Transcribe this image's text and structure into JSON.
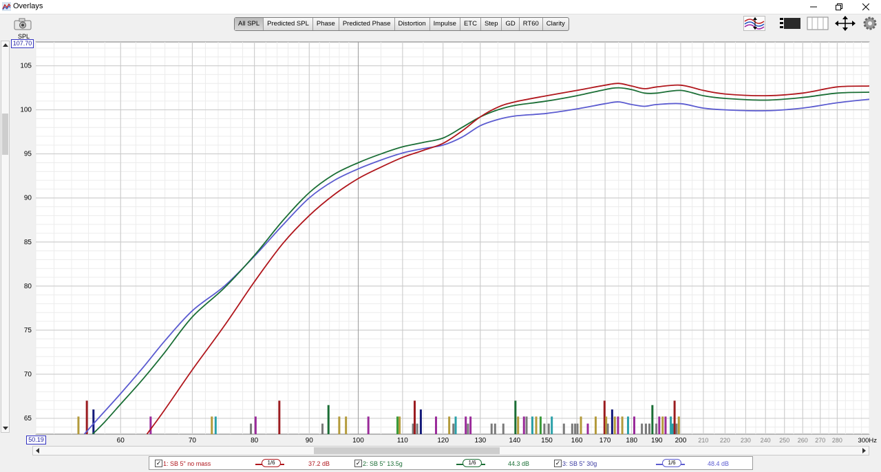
{
  "window": {
    "title": "Overlays"
  },
  "tabs": [
    {
      "label": "All SPL",
      "active": true
    },
    {
      "label": "Predicted SPL"
    },
    {
      "label": "Phase"
    },
    {
      "label": "Predicted Phase"
    },
    {
      "label": "Distortion"
    },
    {
      "label": "Impulse"
    },
    {
      "label": "ETC"
    },
    {
      "label": "Step"
    },
    {
      "label": "GD"
    },
    {
      "label": "RT60"
    },
    {
      "label": "Clarity"
    }
  ],
  "toolbar_icons": [
    "traces-icon",
    "controls-icon",
    "layout-icon",
    "pan-icon",
    "settings-gear-icon"
  ],
  "colors": {
    "red": "#b0161c",
    "green": "#1a6e35",
    "blue": "#5b5bd0",
    "grid": "#d0d0d0",
    "grid_major": "#a0a0a0"
  },
  "chart_data": {
    "type": "line",
    "ylabel": "SPL",
    "xlabel": "Hz",
    "x_scale": "log",
    "xlim": [
      50,
      300
    ],
    "ylim": [
      63.2,
      107.7
    ],
    "ylim_top_label": "107.70",
    "ylim_bottom_label": "50.19",
    "y_ticks": [
      65,
      70,
      75,
      80,
      85,
      90,
      95,
      100,
      105
    ],
    "x_ticks": [
      60,
      70,
      80,
      90,
      100,
      110,
      120,
      130,
      140,
      150,
      160,
      170,
      180,
      190,
      200,
      210,
      220,
      230,
      240,
      250,
      260,
      270,
      280
    ],
    "x_ticks_dark": [
      60,
      70,
      80,
      90,
      100,
      110,
      120,
      130,
      140,
      150,
      160,
      170,
      180,
      190,
      200
    ],
    "x_last_label": "300Hz",
    "grid": true,
    "series": [
      {
        "name": "1: SB 5\" no mass",
        "color": "#b0161c",
        "x": [
          63.5,
          66,
          70,
          75,
          80,
          85,
          90,
          95,
          100,
          105,
          110,
          115,
          120,
          125,
          130,
          135,
          140,
          150,
          160,
          170,
          175,
          180,
          185,
          190,
          200,
          210,
          220,
          240,
          260,
          280,
          300
        ],
        "y": [
          63.2,
          66,
          70.5,
          75.5,
          80.5,
          84.8,
          88,
          90.4,
          92.2,
          93.5,
          94.6,
          95.4,
          96.2,
          97.6,
          99.2,
          100.3,
          100.9,
          101.6,
          102.2,
          102.8,
          103.0,
          102.7,
          102.4,
          102.6,
          102.8,
          102.2,
          101.8,
          101.6,
          101.9,
          102.6,
          102.7
        ]
      },
      {
        "name": "2: SB 5\" 13.5g",
        "color": "#1a6e35",
        "x": [
          56.5,
          58,
          60,
          63,
          66,
          70,
          75,
          80,
          85,
          90,
          95,
          100,
          105,
          110,
          115,
          120,
          125,
          130,
          135,
          140,
          150,
          160,
          170,
          175,
          180,
          185,
          190,
          200,
          210,
          220,
          240,
          260,
          280,
          300
        ],
        "y": [
          63.2,
          64.6,
          66.6,
          69.5,
          72.5,
          76.5,
          79.8,
          83.5,
          87.4,
          90.6,
          92.7,
          94.0,
          95.0,
          95.8,
          96.3,
          96.8,
          98.0,
          99.2,
          100.0,
          100.5,
          101.0,
          101.6,
          102.3,
          102.5,
          102.3,
          101.9,
          101.9,
          102.2,
          101.6,
          101.3,
          101.1,
          101.4,
          101.9,
          102.0
        ]
      },
      {
        "name": "3: SB 5\" 30g",
        "color": "#5b5bd0",
        "x": [
          55.5,
          57,
          60,
          63,
          66,
          70,
          75,
          80,
          85,
          90,
          95,
          100,
          105,
          110,
          115,
          120,
          125,
          130,
          135,
          140,
          150,
          160,
          170,
          175,
          180,
          185,
          190,
          200,
          210,
          220,
          240,
          260,
          280,
          300
        ],
        "y": [
          63.2,
          64.8,
          67.8,
          70.8,
          73.8,
          77.2,
          80.0,
          83.4,
          86.9,
          90.0,
          92.0,
          93.3,
          94.3,
          95.1,
          95.6,
          96.0,
          96.9,
          98.2,
          98.9,
          99.3,
          99.6,
          100.1,
          100.7,
          100.9,
          100.6,
          100.4,
          100.6,
          100.7,
          100.2,
          100.0,
          99.9,
          100.2,
          100.8,
          101.2
        ]
      }
    ],
    "marker_bars": [
      {
        "x": 54.8,
        "top": 65.2,
        "color": "#b39a3a"
      },
      {
        "x": 55.8,
        "top": 67.0,
        "color": "#9b1c20"
      },
      {
        "x": 56.6,
        "top": 66.0,
        "color": "#141a7a"
      },
      {
        "x": 64.0,
        "top": 65.2,
        "color": "#9a2a9a"
      },
      {
        "x": 73.0,
        "top": 65.2,
        "color": "#b39a3a"
      },
      {
        "x": 73.6,
        "top": 65.2,
        "color": "#2aa0a8"
      },
      {
        "x": 79.4,
        "top": 64.4,
        "color": "#7a7a7a"
      },
      {
        "x": 80.2,
        "top": 65.2,
        "color": "#9a2a9a"
      },
      {
        "x": 84.4,
        "top": 67.0,
        "color": "#9b1c20"
      },
      {
        "x": 92.6,
        "top": 64.4,
        "color": "#7a7a7a"
      },
      {
        "x": 93.8,
        "top": 66.5,
        "color": "#1a6e35"
      },
      {
        "x": 96.0,
        "top": 65.2,
        "color": "#b39a3a"
      },
      {
        "x": 97.4,
        "top": 65.2,
        "color": "#b39a3a"
      },
      {
        "x": 102.2,
        "top": 65.2,
        "color": "#9a2a9a"
      },
      {
        "x": 108.8,
        "top": 65.2,
        "color": "#3a9a3a"
      },
      {
        "x": 109.3,
        "top": 65.2,
        "color": "#b39a3a"
      },
      {
        "x": 112.5,
        "top": 64.4,
        "color": "#7a7a7a"
      },
      {
        "x": 112.9,
        "top": 67.0,
        "color": "#9b1c20"
      },
      {
        "x": 113.5,
        "top": 64.4,
        "color": "#7a7a7a"
      },
      {
        "x": 114.4,
        "top": 66.0,
        "color": "#141a7a"
      },
      {
        "x": 118.2,
        "top": 65.2,
        "color": "#9a2a9a"
      },
      {
        "x": 121.6,
        "top": 65.2,
        "color": "#b39a3a"
      },
      {
        "x": 122.7,
        "top": 64.4,
        "color": "#7a7a7a"
      },
      {
        "x": 123.3,
        "top": 65.2,
        "color": "#2aa0a8"
      },
      {
        "x": 126.0,
        "top": 65.2,
        "color": "#9a2a9a"
      },
      {
        "x": 126.6,
        "top": 64.4,
        "color": "#7a7a7a"
      },
      {
        "x": 127.3,
        "top": 65.2,
        "color": "#9a2a9a"
      },
      {
        "x": 133.2,
        "top": 64.4,
        "color": "#7a7a7a"
      },
      {
        "x": 134.2,
        "top": 64.4,
        "color": "#7a7a7a"
      },
      {
        "x": 136.6,
        "top": 64.4,
        "color": "#7a7a7a"
      },
      {
        "x": 140.2,
        "top": 67.0,
        "color": "#1a6e35"
      },
      {
        "x": 141.0,
        "top": 65.2,
        "color": "#b39a3a"
      },
      {
        "x": 142.8,
        "top": 65.2,
        "color": "#9a2a9a"
      },
      {
        "x": 143.6,
        "top": 65.2,
        "color": "#7a7a7a"
      },
      {
        "x": 145.4,
        "top": 65.2,
        "color": "#2aa0a8"
      },
      {
        "x": 146.6,
        "top": 65.2,
        "color": "#b39a3a"
      },
      {
        "x": 148.0,
        "top": 65.2,
        "color": "#3a9a3a"
      },
      {
        "x": 149.2,
        "top": 64.4,
        "color": "#7a7a7a"
      },
      {
        "x": 150.6,
        "top": 64.4,
        "color": "#7a7a7a"
      },
      {
        "x": 151.6,
        "top": 65.2,
        "color": "#2aa0a8"
      },
      {
        "x": 155.6,
        "top": 64.4,
        "color": "#7a7a7a"
      },
      {
        "x": 158.4,
        "top": 64.4,
        "color": "#7a7a7a"
      },
      {
        "x": 159.4,
        "top": 64.4,
        "color": "#7a7a7a"
      },
      {
        "x": 160.2,
        "top": 64.4,
        "color": "#7a7a7a"
      },
      {
        "x": 161.4,
        "top": 65.2,
        "color": "#b39a3a"
      },
      {
        "x": 163.8,
        "top": 64.4,
        "color": "#9a2a9a"
      },
      {
        "x": 166.6,
        "top": 65.2,
        "color": "#b39a3a"
      },
      {
        "x": 169.8,
        "top": 67.0,
        "color": "#9b1c20"
      },
      {
        "x": 170.4,
        "top": 65.2,
        "color": "#b39a3a"
      },
      {
        "x": 171.0,
        "top": 64.4,
        "color": "#7a7a7a"
      },
      {
        "x": 172.6,
        "top": 66.0,
        "color": "#141a7a"
      },
      {
        "x": 173.6,
        "top": 65.2,
        "color": "#b39a3a"
      },
      {
        "x": 174.8,
        "top": 65.2,
        "color": "#9a2a9a"
      },
      {
        "x": 176.4,
        "top": 65.2,
        "color": "#b39a3a"
      },
      {
        "x": 178.6,
        "top": 65.2,
        "color": "#2aa0a8"
      },
      {
        "x": 181.0,
        "top": 65.2,
        "color": "#9a2a9a"
      },
      {
        "x": 184.0,
        "top": 64.4,
        "color": "#7a7a7a"
      },
      {
        "x": 185.6,
        "top": 64.4,
        "color": "#7a7a7a"
      },
      {
        "x": 187.0,
        "top": 64.4,
        "color": "#7a7a7a"
      },
      {
        "x": 188.2,
        "top": 66.5,
        "color": "#1a6e35"
      },
      {
        "x": 189.8,
        "top": 64.4,
        "color": "#7a7a7a"
      },
      {
        "x": 191.0,
        "top": 65.2,
        "color": "#9a2a9a"
      },
      {
        "x": 192.4,
        "top": 65.2,
        "color": "#b39a3a"
      },
      {
        "x": 193.6,
        "top": 65.2,
        "color": "#9a2a9a"
      },
      {
        "x": 195.8,
        "top": 65.2,
        "color": "#2aa0a8"
      },
      {
        "x": 196.6,
        "top": 64.4,
        "color": "#2aa0a8"
      },
      {
        "x": 197.4,
        "top": 67.0,
        "color": "#9b1c20"
      },
      {
        "x": 198.2,
        "top": 64.4,
        "color": "#7a7a7a"
      },
      {
        "x": 199.2,
        "top": 65.2,
        "color": "#b39a3a"
      }
    ]
  },
  "legend": [
    {
      "checked": true,
      "name": "1: SB 5\" no mass",
      "smoothing": "1/6",
      "value": "37.2 dB",
      "color": "#b0161c"
    },
    {
      "checked": true,
      "name": "2: SB 5\" 13.5g",
      "smoothing": "1/6",
      "value": "44.3 dB",
      "color": "#1a6e35"
    },
    {
      "checked": true,
      "name": "3: SB 5\" 30g",
      "smoothing": "1/6",
      "value": "48.4 dB",
      "color": "#5b5bd0"
    }
  ]
}
